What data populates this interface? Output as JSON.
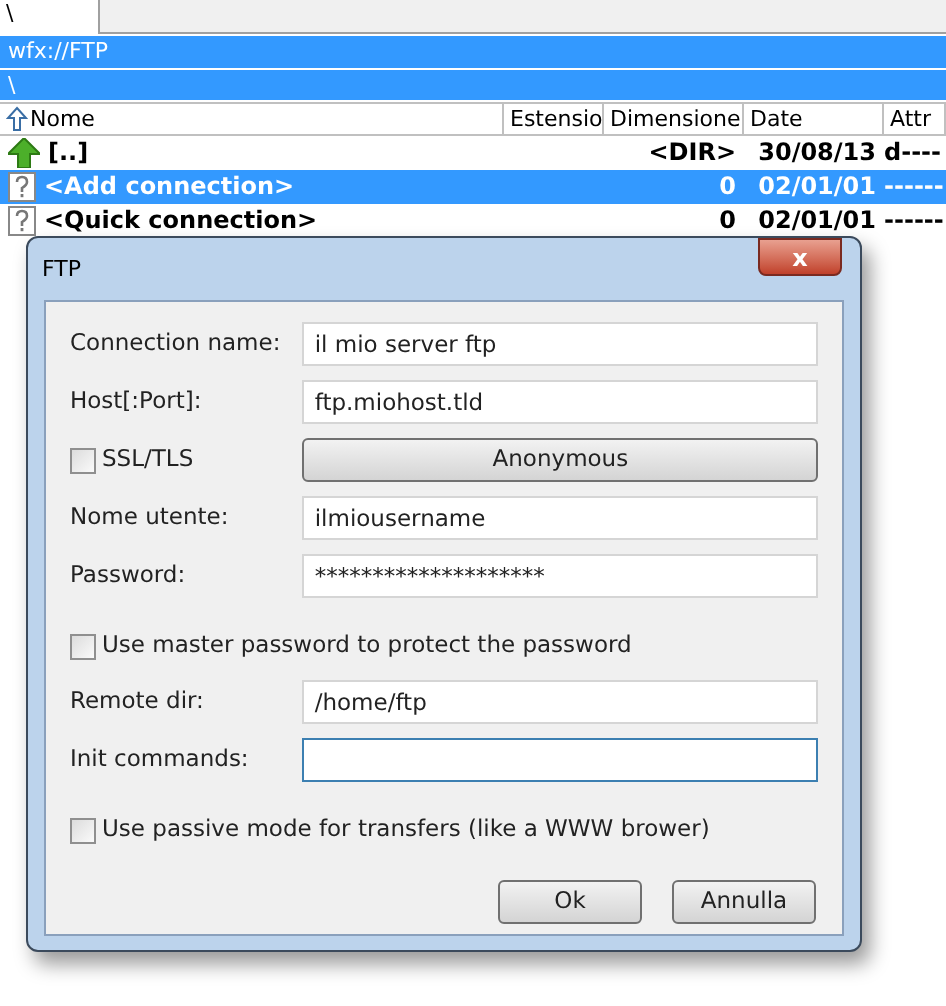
{
  "tab": {
    "label": "\\",
    "selected": true
  },
  "path_bar": {
    "title": "wfx://FTP",
    "path": "\\"
  },
  "file_list": {
    "columns": [
      "Nome",
      "Estensio",
      "Dimensione",
      "Date",
      "Attr"
    ],
    "rows": [
      {
        "kind": "parent",
        "name": "[..]",
        "size": "<DIR>",
        "date": "30/08/13",
        "attr": "d----",
        "selected": false
      },
      {
        "kind": "unknown",
        "name": "<Add connection>",
        "size": "0",
        "date": "02/01/01",
        "attr": "------",
        "selected": true
      },
      {
        "kind": "unknown",
        "name": "<Quick connection>",
        "size": "0",
        "date": "02/01/01",
        "attr": "------",
        "selected": false
      }
    ]
  },
  "dialog": {
    "title": "FTP",
    "close": "x",
    "items": [
      {
        "kind": "field",
        "label": "Connection name:",
        "value": "il mio server ftp",
        "focused": false
      },
      {
        "kind": "field",
        "label": "Host[:Port]:",
        "value": "ftp.miohost.tld",
        "focused": false
      },
      {
        "kind": "check_button",
        "label": "SSL/TLS",
        "checked": false,
        "button": "Anonymous"
      },
      {
        "kind": "field",
        "label": "Nome utente:",
        "value": "ilmiousername",
        "focused": false
      },
      {
        "kind": "field",
        "label": "Password:",
        "value": "********************",
        "focused": false
      },
      {
        "kind": "checkbox",
        "label": "Use master password to protect the password",
        "checked": false
      },
      {
        "kind": "field",
        "label": "Remote dir:",
        "value": "/home/ftp",
        "focused": false
      },
      {
        "kind": "field",
        "label": "Init commands:",
        "value": "",
        "focused": true
      },
      {
        "kind": "checkbox",
        "label": "Use passive mode for transfers (like a WWW brower)",
        "checked": false
      }
    ],
    "buttons": [
      "Ok",
      "Annulla"
    ]
  }
}
